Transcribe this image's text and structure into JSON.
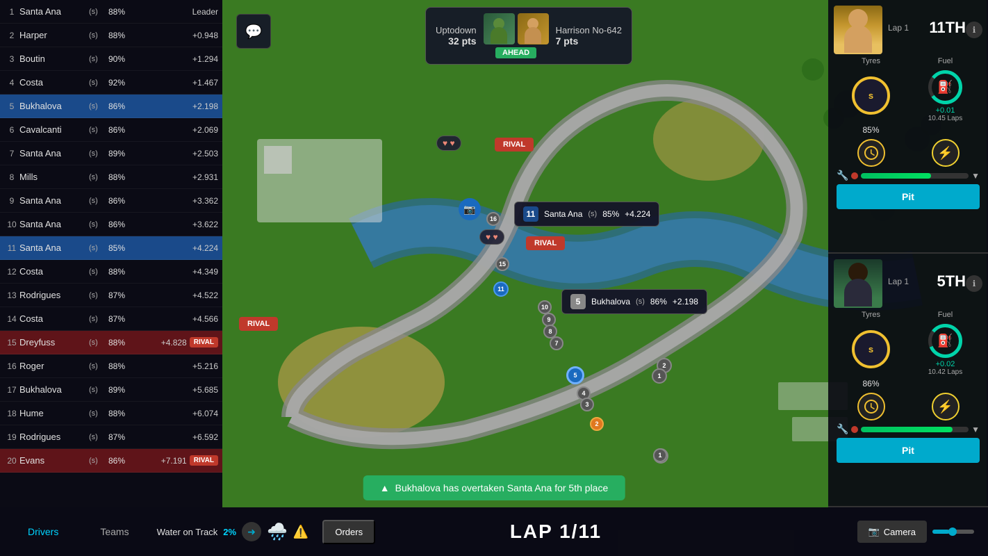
{
  "leaderboard": {
    "rows": [
      {
        "pos": 1,
        "name": "Santa Ana",
        "s": "(s)",
        "pct": "88%",
        "gap": "Leader",
        "highlight": "",
        "rival": false
      },
      {
        "pos": 2,
        "name": "Harper",
        "s": "(s)",
        "pct": "88%",
        "gap": "+0.948",
        "highlight": "",
        "rival": false
      },
      {
        "pos": 3,
        "name": "Boutin",
        "s": "(s)",
        "pct": "90%",
        "gap": "+1.294",
        "highlight": "",
        "rival": false
      },
      {
        "pos": 4,
        "name": "Costa",
        "s": "(s)",
        "pct": "92%",
        "gap": "+1.467",
        "highlight": "",
        "rival": false
      },
      {
        "pos": 5,
        "name": "Bukhalova",
        "s": "(s)",
        "pct": "86%",
        "gap": "+2.198",
        "highlight": "blue",
        "rival": false
      },
      {
        "pos": 6,
        "name": "Cavalcanti",
        "s": "(s)",
        "pct": "86%",
        "gap": "+2.069",
        "highlight": "",
        "rival": false
      },
      {
        "pos": 7,
        "name": "Santa Ana",
        "s": "(s)",
        "pct": "89%",
        "gap": "+2.503",
        "highlight": "",
        "rival": false
      },
      {
        "pos": 8,
        "name": "Mills",
        "s": "(s)",
        "pct": "88%",
        "gap": "+2.931",
        "highlight": "",
        "rival": false
      },
      {
        "pos": 9,
        "name": "Santa Ana",
        "s": "(s)",
        "pct": "86%",
        "gap": "+3.362",
        "highlight": "",
        "rival": false
      },
      {
        "pos": 10,
        "name": "Santa Ana",
        "s": "(s)",
        "pct": "86%",
        "gap": "+3.622",
        "highlight": "",
        "rival": false
      },
      {
        "pos": 11,
        "name": "Santa Ana",
        "s": "(s)",
        "pct": "85%",
        "gap": "+4.224",
        "highlight": "blue",
        "rival": false
      },
      {
        "pos": 12,
        "name": "Costa",
        "s": "(s)",
        "pct": "88%",
        "gap": "+4.349",
        "highlight": "",
        "rival": false
      },
      {
        "pos": 13,
        "name": "Rodrigues",
        "s": "(s)",
        "pct": "87%",
        "gap": "+4.522",
        "highlight": "",
        "rival": false
      },
      {
        "pos": 14,
        "name": "Costa",
        "s": "(s)",
        "pct": "87%",
        "gap": "+4.566",
        "highlight": "",
        "rival": false
      },
      {
        "pos": 15,
        "name": "Dreyfuss",
        "s": "(s)",
        "pct": "88%",
        "gap": "+4.828",
        "highlight": "red",
        "rival": true
      },
      {
        "pos": 16,
        "name": "Roger",
        "s": "(s)",
        "pct": "88%",
        "gap": "+5.216",
        "highlight": "",
        "rival": false
      },
      {
        "pos": 17,
        "name": "Bukhalova",
        "s": "(s)",
        "pct": "89%",
        "gap": "+5.685",
        "highlight": "",
        "rival": false
      },
      {
        "pos": 18,
        "name": "Hume",
        "s": "(s)",
        "pct": "88%",
        "gap": "+6.074",
        "highlight": "",
        "rival": false
      },
      {
        "pos": 19,
        "name": "Rodrigues",
        "s": "(s)",
        "pct": "87%",
        "gap": "+6.592",
        "highlight": "",
        "rival": false
      },
      {
        "pos": 20,
        "name": "Evans",
        "s": "(s)",
        "pct": "86%",
        "gap": "+7.191",
        "highlight": "red",
        "rival": true
      }
    ]
  },
  "right_panel": {
    "driver1": {
      "lap": "Lap 1",
      "position": "11TH",
      "tyres_label": "Tyres",
      "fuel_label": "Fuel",
      "tyre_type": "s",
      "tyre_pct": "85%",
      "fuel_change": "+0.01",
      "fuel_laps": "10.45 Laps",
      "speed_pct": "65%",
      "pit_label": "Pit"
    },
    "driver2": {
      "lap": "Lap 1",
      "position": "5TH",
      "tyres_label": "Tyres",
      "fuel_label": "Fuel",
      "tyre_type": "s",
      "tyre_pct": "86%",
      "fuel_change": "+0.02",
      "fuel_laps": "10.42 Laps",
      "speed_pct": "85%",
      "pit_label": "Pit"
    }
  },
  "hud": {
    "chat_icon": "💬",
    "platform_name": "Uptodown",
    "platform_pts": "32 pts",
    "ahead_label": "AHEAD",
    "opponent_name": "Harrison No-642",
    "opponent_pts": "7 pts"
  },
  "map_overlays": {
    "tooltip_11": {
      "num": "11",
      "name": "Santa Ana",
      "s": "(s)",
      "pct": "85%",
      "gap": "+4.224"
    },
    "tooltip_5": {
      "num": "5",
      "name": "Bukhalova",
      "s": "(s)",
      "pct": "86%",
      "gap": "+2.198"
    },
    "rival_top": "RIVAL",
    "rival_bottom": "RIVAL",
    "rival_left": "RIVAL"
  },
  "notification": {
    "text": "Bukhalova has overtaken Santa Ana for 5th place",
    "icon": "▲"
  },
  "bottom_bar": {
    "tab_drivers": "Drivers",
    "tab_teams": "Teams",
    "water_label": "Water on Track",
    "water_pct": "2%",
    "orders_label": "Orders",
    "lap_display": "LAP 1/11",
    "camera_label": "Camera"
  },
  "colors": {
    "accent_blue": "#00d4ff",
    "rival_red": "#c0392b",
    "green_pos": "#27ae60",
    "tyre_yellow": "#f0c030",
    "fuel_teal": "#00d4aa"
  }
}
